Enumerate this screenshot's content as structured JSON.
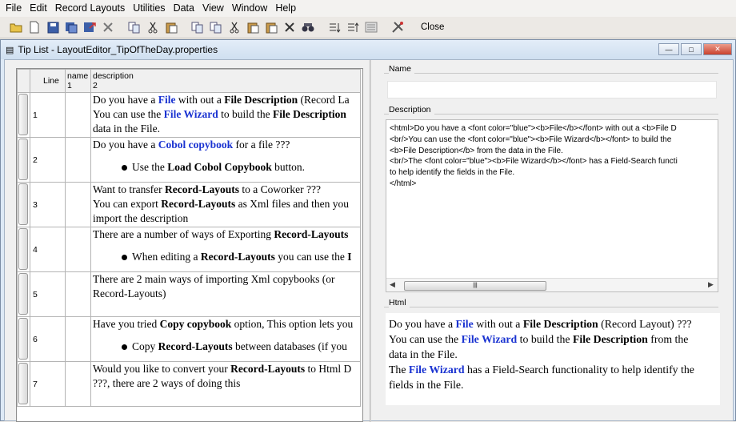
{
  "menu": [
    "File",
    "Edit",
    "Record Layouts",
    "Utilities",
    "Data",
    "View",
    "Window",
    "Help"
  ],
  "toolbar": {
    "close_label": "Close"
  },
  "window": {
    "title": "Tip List - LayoutEditor_TipOfTheDay.properties"
  },
  "table": {
    "headers": {
      "line": "Line",
      "name": "name",
      "name_num": "1",
      "desc": "description",
      "desc_num": "2"
    },
    "rows": [
      {
        "line": "1",
        "lines": [
          "Do you have a |File| with out a |File Description| (Record La",
          "You can use the |File Wizard| to build the |File Description",
          "data in the File."
        ]
      },
      {
        "line": "2",
        "lines": [
          "Do you have a |Cobol copybook| for a file ???"
        ],
        "bullet": "Use the |Load Cobol Copybook| button."
      },
      {
        "line": "3",
        "lines": [
          "Want to transfer |Record-Layouts| to a Coworker ???",
          "You can export |Record-Layouts| as Xml files and then you",
          "import the description"
        ]
      },
      {
        "line": "4",
        "lines": [
          "There are a number of ways of Exporting |Record-Layouts|"
        ],
        "bullet": "When editing a |Record-Layouts| you can use the |I"
      },
      {
        "line": "5",
        "lines": [
          "There are 2 main ways of importing Xml copybooks (or",
          "Record-Layouts)"
        ]
      },
      {
        "line": "6",
        "lines": [
          "Have you tried |Copy copybook| option, This option lets you"
        ],
        "bullet": "Copy |Record-Layouts| between databases (if you"
      },
      {
        "line": "7",
        "lines": [
          "Would you like to convert your |Record-Layouts| to Html D",
          "???, there are 2 ways of doing this"
        ]
      }
    ]
  },
  "detail": {
    "name_label": "Name",
    "desc_label": "Description",
    "html_label": "Html",
    "desc_text": "<html>Do you have a <font color=\"blue\"><b>File</b></font> with out a <b>File D\n<br/>You can use the <font color=\"blue\"><b>File Wizard</b></font> to build the\n<b>File Description</b> from the data in the File.\n<br/>The <font color=\"blue\"><b>File Wizard</b></font> has a Field-Search functi\nto help identify the fields in the File.\n</html>",
    "html_lines": [
      "Do you have a |File| with out a |File Description| (Record Layout) ???",
      "You can use the |File Wizard| to build the |File Description| from the",
      "data in the File.",
      "The |File Wizard| has a Field-Search functionality to help identify the",
      "fields in the File."
    ]
  },
  "blue_color": "#1a33d1",
  "icons": [
    "open-folder-icon",
    "new-file-icon",
    "save-icon",
    "save-as-icon",
    "export-icon",
    "delete-icon",
    "copy-icon",
    "cut-icon",
    "paste-icon",
    "find-icon",
    "sort-icon",
    "tools-icon"
  ]
}
